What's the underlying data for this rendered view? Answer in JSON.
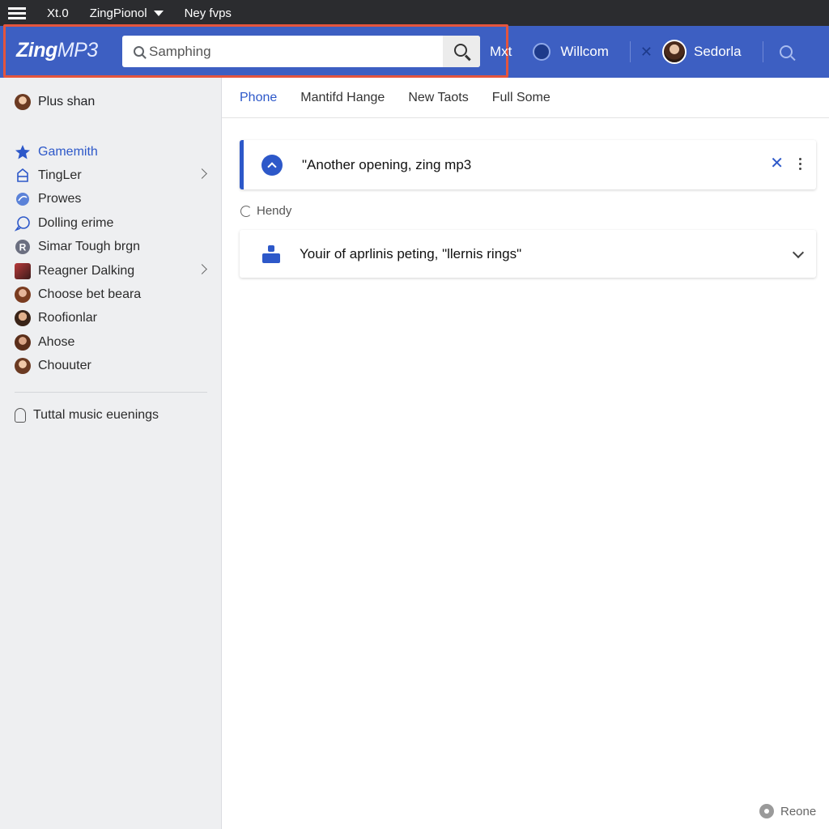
{
  "topbar": {
    "items": [
      "Xt.0",
      "ZingPionol",
      "Ney fvps"
    ]
  },
  "header": {
    "logo_bold": "Zing",
    "logo_light": "MP3",
    "search_placeholder": "Samphing",
    "next_label": "Mxt",
    "welcome_label": "Willcom",
    "user_label": "Sedorla"
  },
  "sidebar": {
    "top_label": "Plus shan",
    "items": [
      {
        "label": "Gamemith",
        "icon": "star-icon",
        "active": true
      },
      {
        "label": "TingLer",
        "icon": "tag-icon",
        "has_chevron": true
      },
      {
        "label": "Prowes",
        "icon": "globe-icon"
      },
      {
        "label": "Dolling erime",
        "icon": "chat-icon"
      },
      {
        "label": "Simar Tough brgn",
        "icon": "r-badge-icon"
      },
      {
        "label": "Reagner Dalking",
        "icon": "album-icon",
        "has_chevron": true
      },
      {
        "label": "Choose bet beara",
        "icon": "avatar-icon"
      },
      {
        "label": "Roofionlar",
        "icon": "avatar-icon"
      },
      {
        "label": "Ahose",
        "icon": "avatar-icon"
      },
      {
        "label": "Chouuter",
        "icon": "avatar-icon"
      }
    ],
    "bottom_label": "Tuttal music euenings"
  },
  "tabs": [
    "Phone",
    "Mantifd Hange",
    "New Taots",
    "Full Some"
  ],
  "active_tab": "Phone",
  "card1": {
    "text": "\"Another opening, zing mp3"
  },
  "section_label": "Hendy",
  "card2": {
    "text": "Youir of aprlinis peting, \"llernis rings\""
  },
  "footer_label": "Reone",
  "colors": {
    "accent": "#3d5fc2",
    "link": "#2d58c9",
    "highlight_border": "#e4553d"
  }
}
